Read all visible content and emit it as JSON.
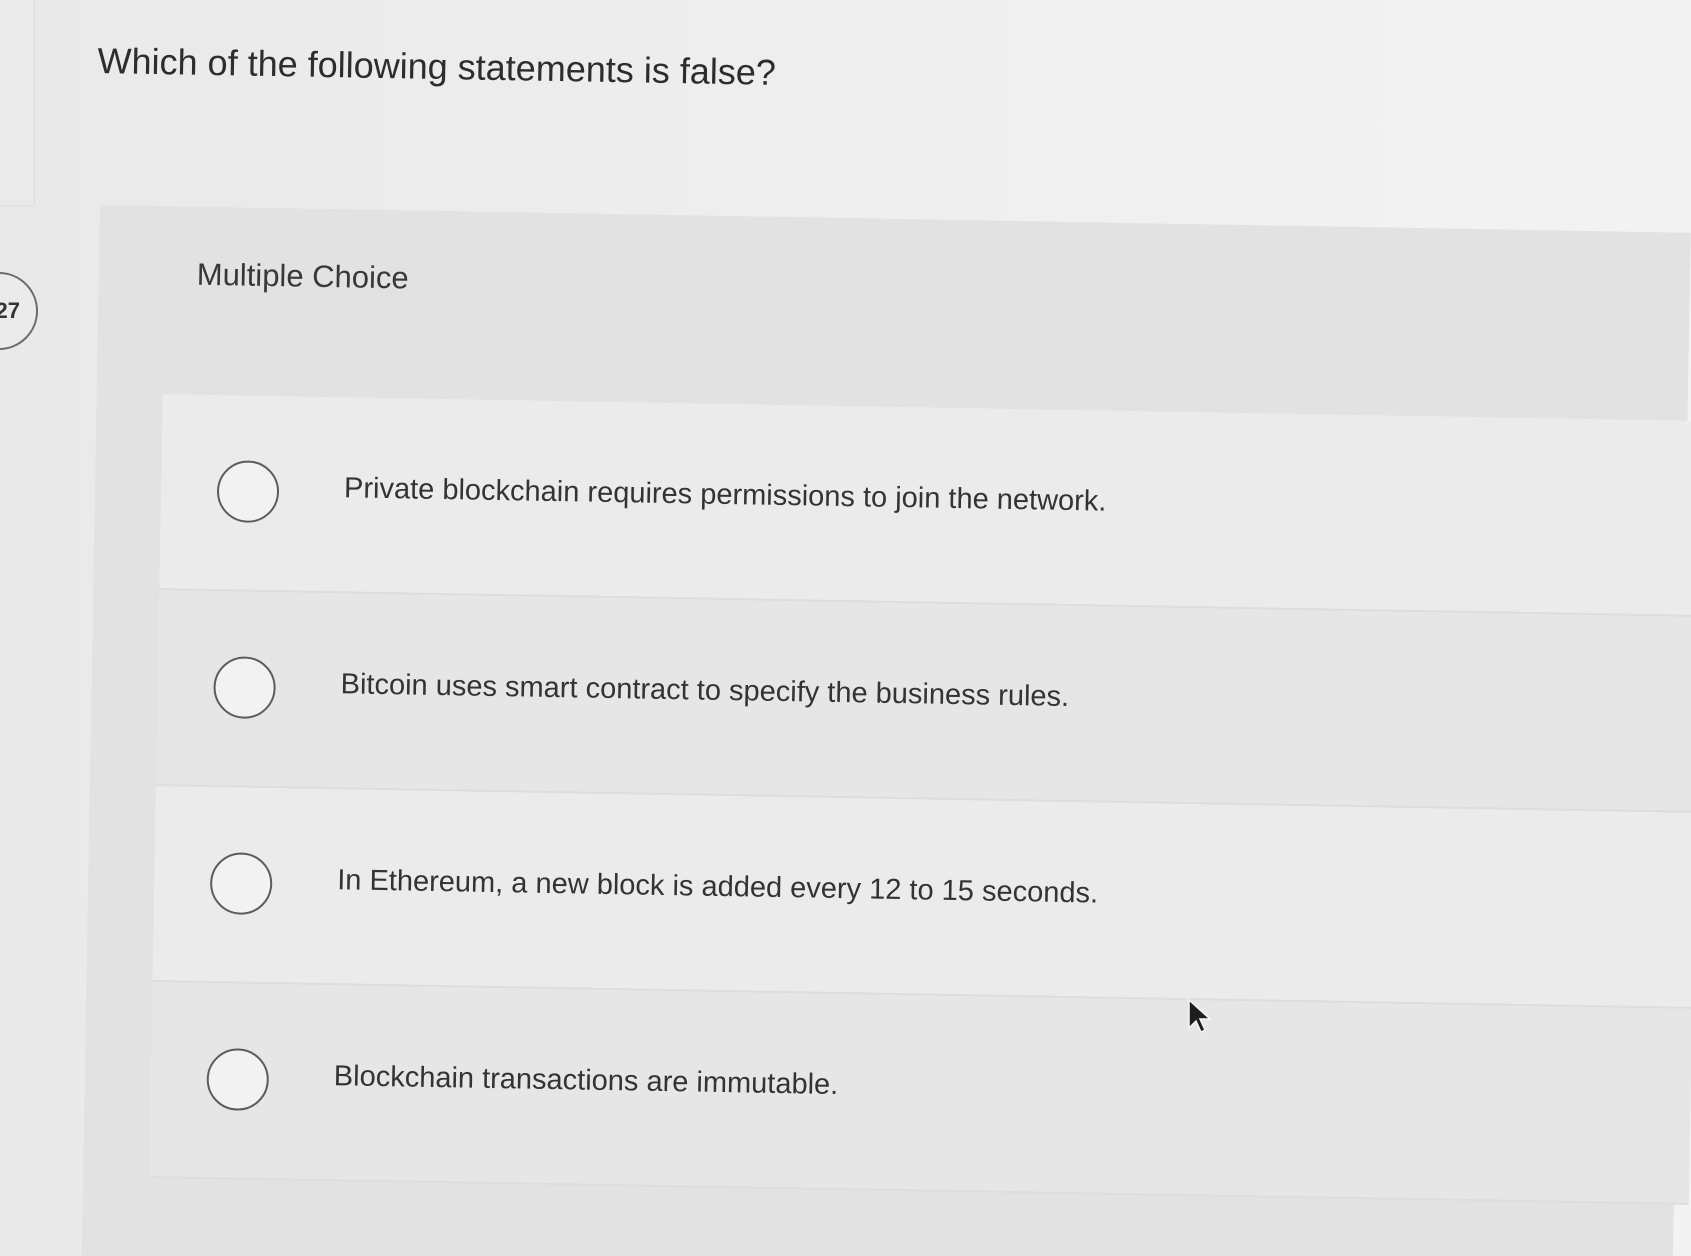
{
  "question": {
    "number": "27",
    "text": "Which of the following statements is false?"
  },
  "panel": {
    "label": "Multiple Choice"
  },
  "options": [
    {
      "text": "Private blockchain requires permissions to join the network.",
      "selected": false
    },
    {
      "text": "Bitcoin uses smart contract to specify the business rules.",
      "selected": false
    },
    {
      "text": "In Ethereum, a new block is added every 12 to 15 seconds.",
      "selected": false
    },
    {
      "text": "Blockchain transactions are immutable.",
      "selected": false
    }
  ],
  "icons": {
    "radio": "radio-circle-icon",
    "cursor": "mouse-pointer-icon"
  }
}
